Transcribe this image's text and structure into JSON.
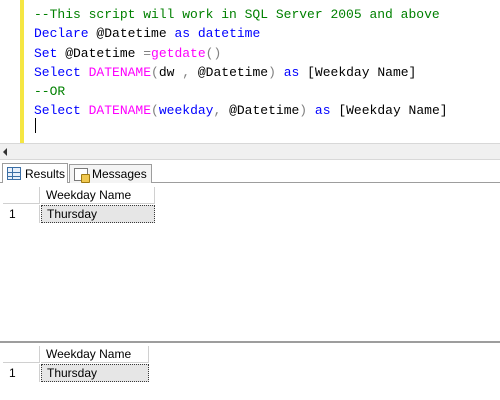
{
  "editor": {
    "lines": [
      [
        {
          "t": "--This script will work in SQL Server 2005 and above",
          "c": "comment"
        }
      ],
      [
        {
          "t": "Declare",
          "c": "kw"
        },
        {
          "t": " @Datetime ",
          "c": "plain"
        },
        {
          "t": "as",
          "c": "kw"
        },
        {
          "t": " ",
          "c": "plain"
        },
        {
          "t": "datetime",
          "c": "kw"
        }
      ],
      [
        {
          "t": "Set",
          "c": "kw"
        },
        {
          "t": " @Datetime ",
          "c": "plain"
        },
        {
          "t": "=",
          "c": "op"
        },
        {
          "t": "getdate",
          "c": "fn"
        },
        {
          "t": "()",
          "c": "op"
        }
      ],
      [
        {
          "t": "Select",
          "c": "kw"
        },
        {
          "t": " ",
          "c": "plain"
        },
        {
          "t": "DATENAME",
          "c": "fn"
        },
        {
          "t": "(",
          "c": "op"
        },
        {
          "t": "dw ",
          "c": "plain"
        },
        {
          "t": ",",
          "c": "op"
        },
        {
          "t": " @Datetime",
          "c": "plain"
        },
        {
          "t": ")",
          "c": "op"
        },
        {
          "t": " ",
          "c": "plain"
        },
        {
          "t": "as",
          "c": "kw"
        },
        {
          "t": " [Weekday Name]",
          "c": "plain"
        }
      ],
      [
        {
          "t": "--OR",
          "c": "comment"
        }
      ],
      [
        {
          "t": "Select",
          "c": "kw"
        },
        {
          "t": " ",
          "c": "plain"
        },
        {
          "t": "DATENAME",
          "c": "fn"
        },
        {
          "t": "(",
          "c": "op"
        },
        {
          "t": "weekday",
          "c": "kw"
        },
        {
          "t": ",",
          "c": "op"
        },
        {
          "t": " @Datetime",
          "c": "plain"
        },
        {
          "t": ")",
          "c": "op"
        },
        {
          "t": " ",
          "c": "plain"
        },
        {
          "t": "as",
          "c": "kw"
        },
        {
          "t": " [Weekday Name]",
          "c": "plain"
        }
      ]
    ]
  },
  "tabs": {
    "results_label": "Results",
    "messages_label": "Messages"
  },
  "grid1": {
    "column": "Weekday Name",
    "rows": [
      {
        "num": "1",
        "value": "Thursday"
      }
    ]
  },
  "grid2": {
    "column": "Weekday Name",
    "rows": [
      {
        "num": "1",
        "value": "Thursday"
      }
    ]
  },
  "colors": {
    "comment": "#008000",
    "keyword": "#0000ff",
    "function": "#ff00ff",
    "operator": "#808080",
    "changebar": "#f5e642"
  }
}
